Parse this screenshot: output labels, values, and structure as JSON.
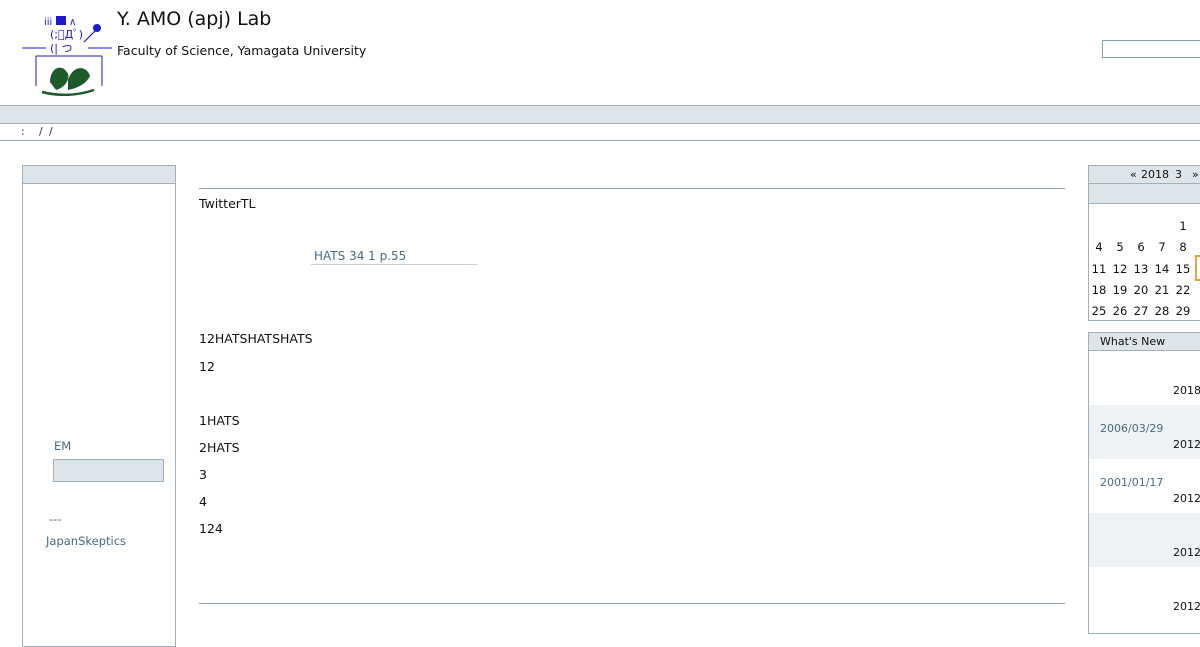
{
  "header": {
    "title": "Y. AMO (apj) Lab",
    "subtitle": "Faculty of Science, Yamagata University",
    "logo_text": "iii ■ ∧ (;ﾟДﾟ) (| つ"
  },
  "breadcrumb": {
    "colon": ":",
    "sep1": "/",
    "sep2": "/"
  },
  "left": {
    "em_label": "EM",
    "em_value": "",
    "dash_text": "---",
    "link": "JapanSkeptics"
  },
  "main": {
    "line1": "TwitterTL",
    "citation": "HATS      34  1 p.55",
    "p1": "12HATSHATSHATS",
    "p2": "12",
    "item1": "1HATS",
    "item2": "2HATS",
    "item3": "3",
    "item4": "4",
    "item5": "124"
  },
  "calendar": {
    "prev": "«",
    "year": "2018",
    "month": "3",
    "next": "»",
    "weeks": [
      [
        "",
        "",
        "",
        "",
        "1"
      ],
      [
        "4",
        "5",
        "6",
        "7",
        "8"
      ],
      [
        "11",
        "12",
        "13",
        "14",
        "15"
      ],
      [
        "18",
        "19",
        "20",
        "21",
        "22"
      ],
      [
        "25",
        "26",
        "27",
        "28",
        "29"
      ]
    ]
  },
  "whats_new": {
    "title": "What's New",
    "rows": [
      {
        "date": "",
        "year": "2018",
        "bg": "#ffffff"
      },
      {
        "date": "2006/03/29",
        "year": "2012",
        "bg": "#eef2f5"
      },
      {
        "date": "2001/01/17",
        "year": "2012",
        "bg": "#ffffff"
      },
      {
        "date": "",
        "year": "2012",
        "bg": "#eef2f5"
      },
      {
        "date": "",
        "year": "2012",
        "bg": "#ffffff"
      }
    ]
  },
  "colors": {
    "accent": "#4a6a82",
    "band": "#dde5ea",
    "border": "#9fb1bc",
    "today": "#e8a33a"
  }
}
